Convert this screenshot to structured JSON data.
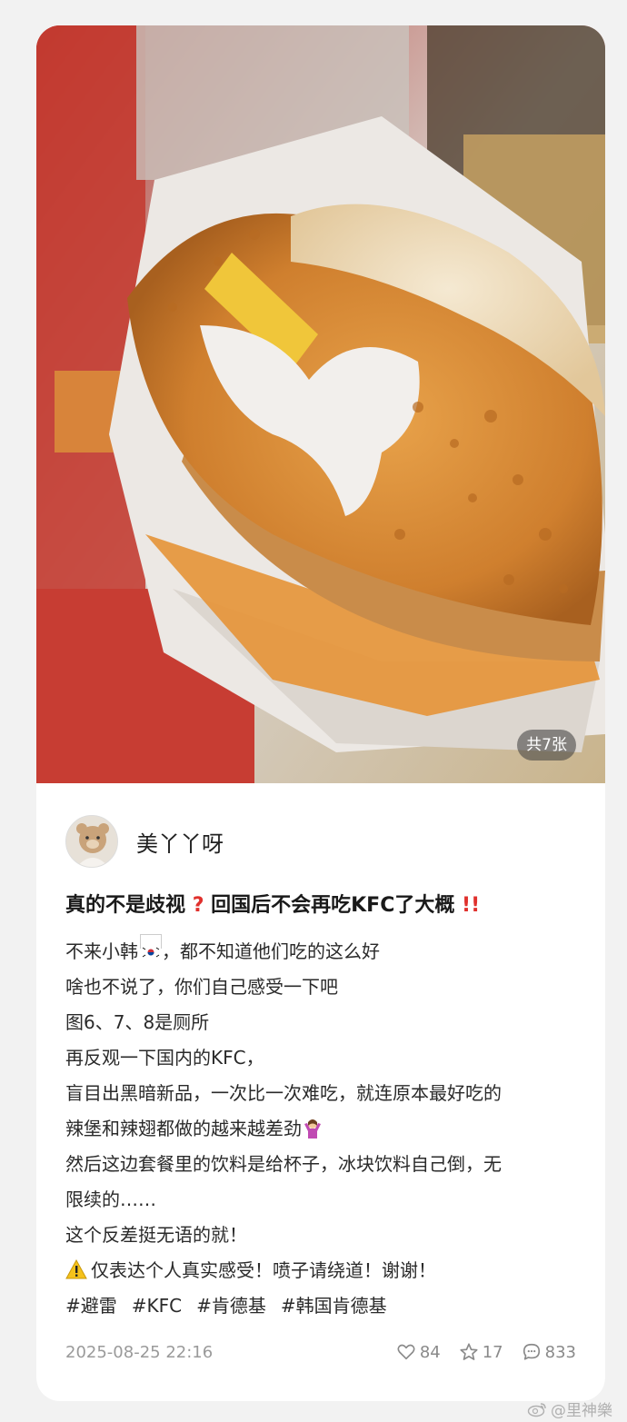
{
  "photo": {
    "image_count_label": "共7张",
    "scene_description_icon": "burger-photo"
  },
  "author": {
    "name": "美丫丫呀",
    "avatar_icon": "bear-avatar-icon"
  },
  "post": {
    "title_text": "真的不是歧视",
    "title_text_2": "回国后不会再吃KFC了大概",
    "lines": {
      "l1": "不来小韩",
      "l1b": "，都不知道他们吃的这么好",
      "l2": "啥也不说了，你们自己感受一下吧",
      "l3": "图6、7、8是厕所",
      "l4": "再反观一下国内的KFC，",
      "l5": "盲目出黑暗新品，一次比一次难吃，就连原本最好吃的",
      "l6": "辣堡和辣翅都做的越来越差劲",
      "l7": "然后这边套餐里的饮料是给杯子，冰块饮料自己倒，无",
      "l8": "限续的……",
      "l9": "这个反差挺无语的就！",
      "l10": "仅表达个人真实感受！喷子请绕道！谢谢！"
    },
    "tags": [
      "#避雷",
      "#KFC",
      "#肯德基",
      "#韩国肯德基"
    ]
  },
  "footer": {
    "timestamp": "2025-08-25 22:16",
    "likes": "84",
    "favorites": "17",
    "comments": "833"
  },
  "watermark": {
    "label": "@里神樂"
  },
  "colors": {
    "accent_red": "#e0302c",
    "meta_gray": "#9a9a9a",
    "background": "#f2f2f2"
  }
}
